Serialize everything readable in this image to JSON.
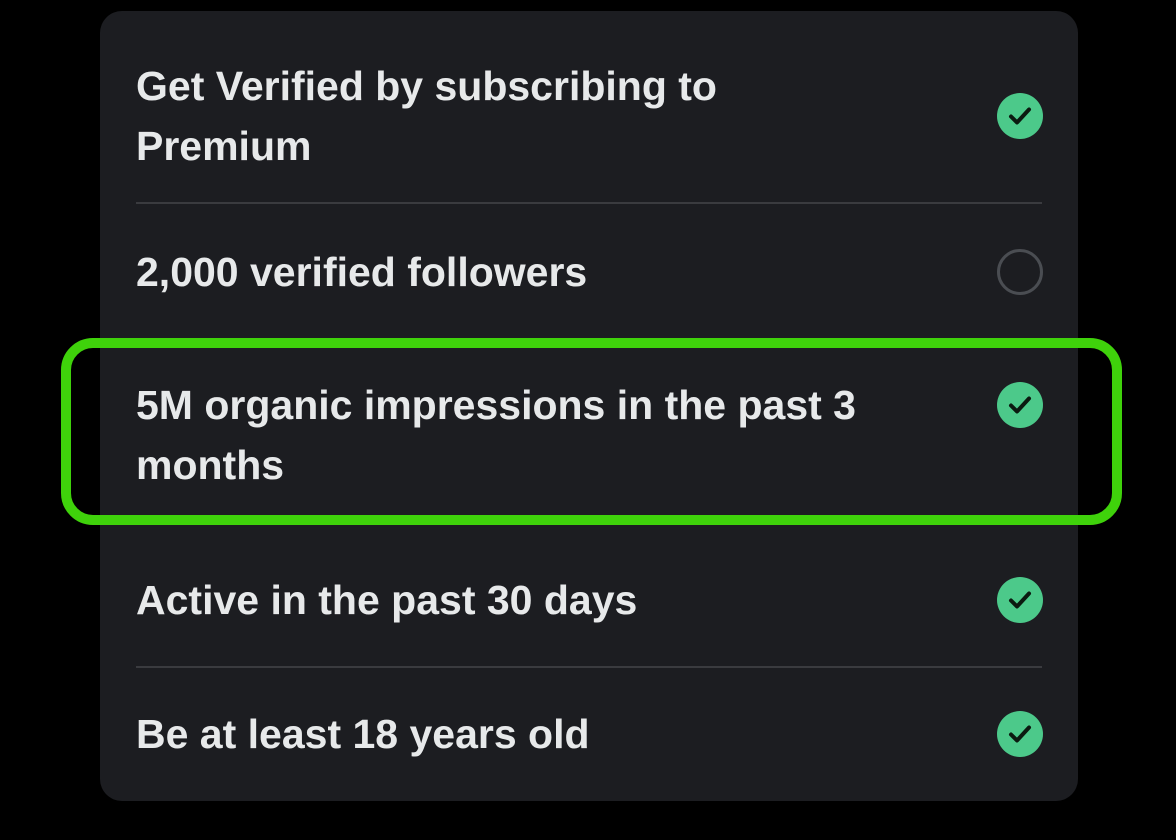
{
  "colors": {
    "background": "#000000",
    "card": "#1c1d21",
    "text": "#e7e9ea",
    "divider": "#3a3b3f",
    "check_fill": "#4cc98a",
    "check_mark": "#0b1a10",
    "empty_circle": "#4a4d52",
    "highlight": "#3fd20b"
  },
  "requirements": [
    {
      "label": "Get Verified by subscribing to Premium",
      "status": "complete",
      "icon": "check-circle-icon"
    },
    {
      "label": "2,000 verified followers",
      "status": "incomplete",
      "icon": "empty-circle-icon"
    },
    {
      "label": "5M organic impressions in the past 3 months",
      "status": "complete",
      "icon": "check-circle-icon",
      "highlighted": true
    },
    {
      "label": "Active in the past 30 days",
      "status": "complete",
      "icon": "check-circle-icon"
    },
    {
      "label": "Be at least 18 years old",
      "status": "complete",
      "icon": "check-circle-icon"
    }
  ]
}
